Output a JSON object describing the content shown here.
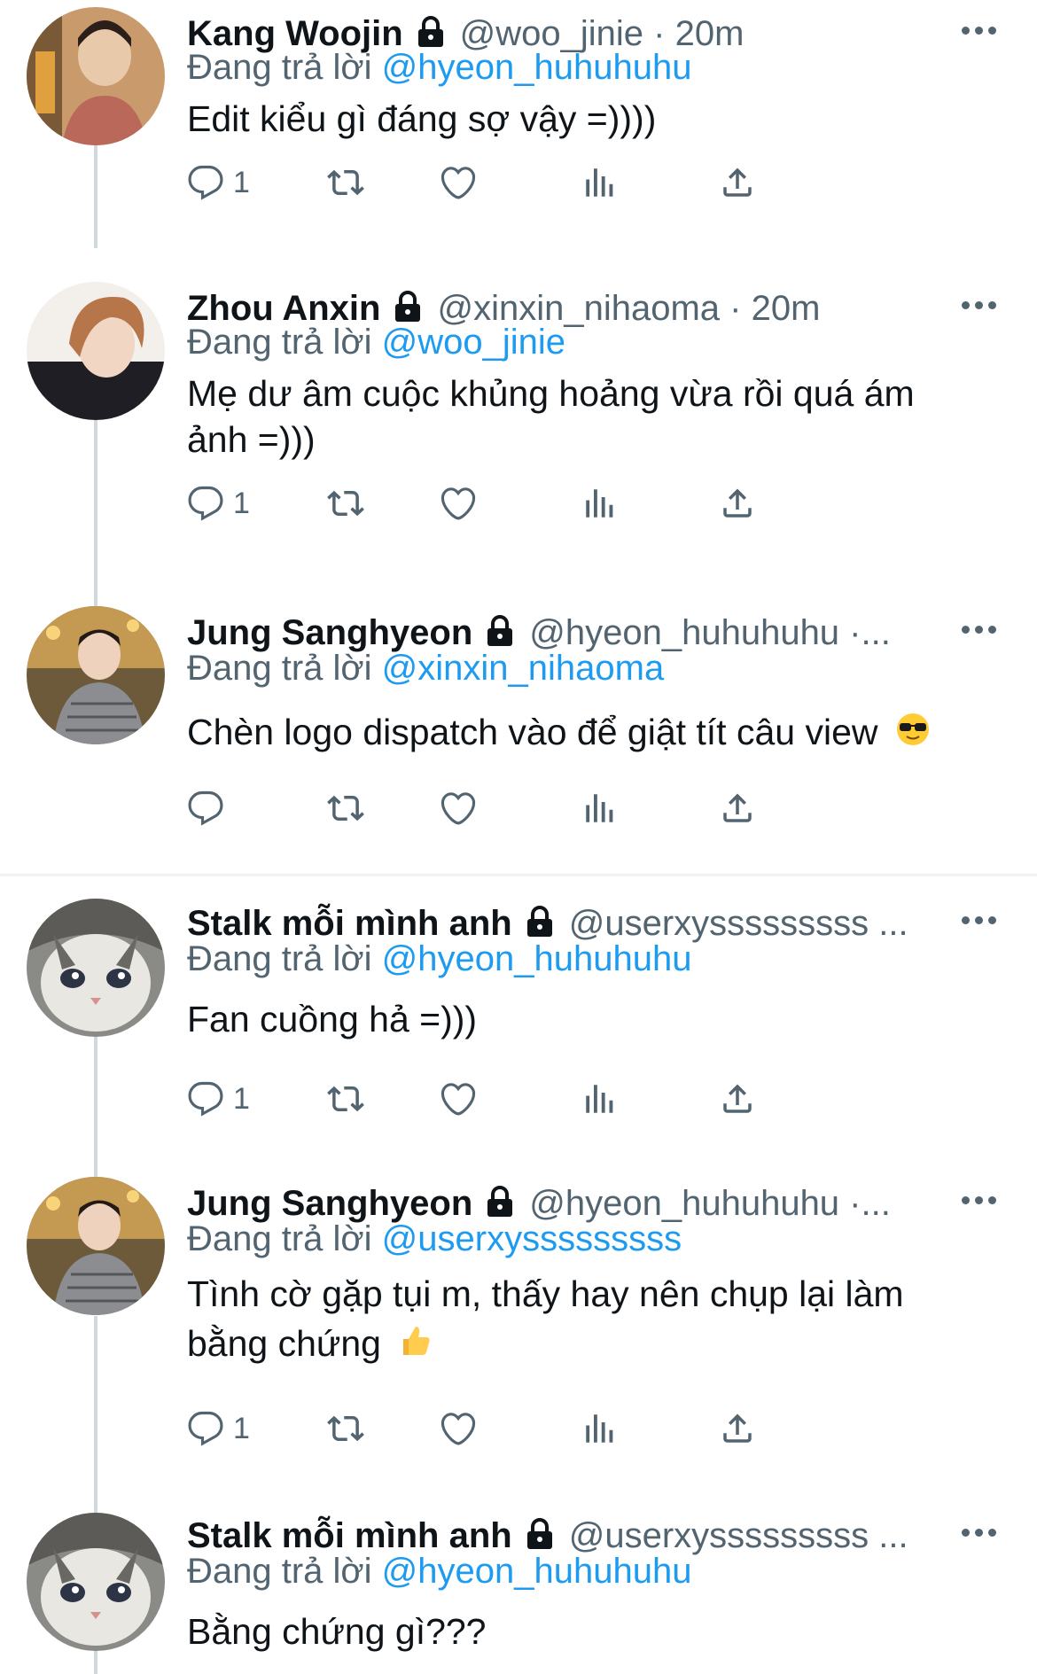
{
  "reply_prefix": "Đang trả lời",
  "tweets": [
    {
      "name": "Kang Woojin",
      "handle": "@woo_jinie · 20m",
      "replying_to": "@hyeon_huhuhuhu",
      "text": "Edit kiểu gì đáng sợ vậy =))))",
      "reply_count": "1"
    },
    {
      "name": "Zhou Anxin",
      "handle": "@xinxin_nihaoma · 20m",
      "replying_to": "@woo_jinie",
      "text": "Mẹ dư âm cuộc khủng hoảng vừa rồi quá ám ảnh =)))",
      "reply_count": "1"
    },
    {
      "name": "Jung Sanghyeon",
      "handle": "@hyeon_huhuhuhu ·...",
      "replying_to": "@xinxin_nihaoma",
      "text": "Chèn logo dispatch vào để giật tít câu view",
      "reply_count": ""
    },
    {
      "name": "Stalk mỗi mình anh",
      "handle": "@userxysssssssss ...",
      "replying_to": "@hyeon_huhuhuhu",
      "text": "Fan cuồng hả =)))",
      "reply_count": "1"
    },
    {
      "name": "Jung Sanghyeon",
      "handle": "@hyeon_huhuhuhu ·...",
      "replying_to": "@userxysssssssss",
      "text": "Tình cờ gặp tụi m, thấy hay nên chụp lại làm bằng chứng",
      "reply_count": "1"
    },
    {
      "name": "Stalk mỗi mình anh",
      "handle": "@userxysssssssss ...",
      "replying_to": "@hyeon_huhuhuhu",
      "text": "Bằng chứng gì???",
      "reply_count": ""
    }
  ],
  "icons": {
    "lock": "lock-icon",
    "more": "more-icon",
    "reply": "reply-icon",
    "retweet": "retweet-icon",
    "like": "heart-icon",
    "views": "views-icon",
    "share": "share-icon"
  },
  "colors": {
    "link": "#1d9bf0",
    "secondary_text": "#536471",
    "primary_text": "#0f1419",
    "thread_line": "#cfd9de"
  }
}
